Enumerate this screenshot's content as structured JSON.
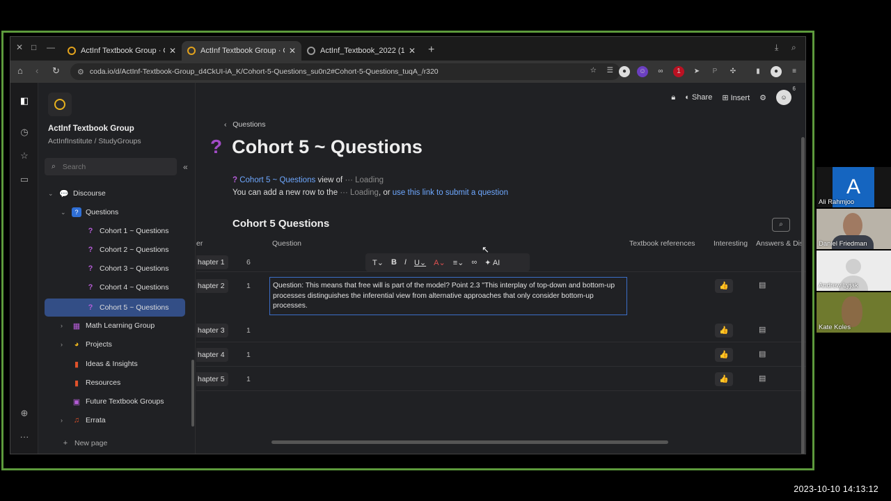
{
  "browser": {
    "tabs": [
      {
        "title": "ActInf Textbook Group · C",
        "active": false
      },
      {
        "title": "ActInf Textbook Group · C",
        "active": true
      },
      {
        "title": "ActInf_Textbook_2022 (1)",
        "active": false
      }
    ],
    "url": "coda.io/d/ActInf-Textbook-Group_d4CkUI-iA_K/Cohort-5-Questions_su0n2#Cohort-5-Questions_tuqA_/r320"
  },
  "sidebar": {
    "doc_name": "ActInf Textbook Group",
    "doc_path": "ActInfInstitute / StudyGroups",
    "search_placeholder": "Search",
    "items": [
      {
        "label": "Discourse"
      },
      {
        "label": "Questions"
      },
      {
        "label": "Cohort 1 ~ Questions"
      },
      {
        "label": "Cohort 2 ~ Questions"
      },
      {
        "label": "Cohort 3 ~ Questions"
      },
      {
        "label": "Cohort 4 ~ Questions"
      },
      {
        "label": "Cohort 5 ~ Questions"
      },
      {
        "label": "Math Learning Group"
      },
      {
        "label": "Projects"
      },
      {
        "label": "Ideas & Insights"
      },
      {
        "label": "Resources"
      },
      {
        "label": "Future Textbook Groups"
      },
      {
        "label": "Errata"
      }
    ],
    "new_page": "New page"
  },
  "topbar": {
    "share": "Share",
    "insert": "Insert",
    "avatar_count": "6"
  },
  "page": {
    "breadcrumb": "Questions",
    "title": "Cohort 5 ~ Questions",
    "view_link": "Cohort 5 ~ Questions",
    "view_of": "view of",
    "loading": "Loading",
    "add_row_text": "You can add a new row to the",
    "or_text": ", or",
    "submit_link": "use this link to submit a question",
    "section_title": "Cohort 5 Questions"
  },
  "table": {
    "headers": {
      "chapter": "er",
      "question": "Question",
      "refs": "Textbook references",
      "interesting": "Interesting",
      "answers": "Answers & Dis"
    },
    "rows": [
      {
        "chapter": "hapter 1",
        "count": "6"
      },
      {
        "chapter": "hapter 2",
        "count": "1",
        "question": "Question: This means that free will is part of the model? Point 2.3 \"This interplay of top-down and bottom-up processes distinguishes the inferential view from alternative approaches that only consider bottom-up processes."
      },
      {
        "chapter": "hapter 3",
        "count": "1"
      },
      {
        "chapter": "hapter 4",
        "count": "1"
      },
      {
        "chapter": "hapter 5",
        "count": "1"
      }
    ]
  },
  "format_toolbar": {
    "ai": "AI"
  },
  "participants": [
    {
      "name": "Ali Rahmjoo",
      "initial": "A",
      "color": "#1565c0"
    },
    {
      "name": "Daniel Friedman"
    },
    {
      "name": "Andrew Lyjak"
    },
    {
      "name": "Kate Koles"
    }
  ],
  "timestamp": "2023-10-10  14:13:12"
}
